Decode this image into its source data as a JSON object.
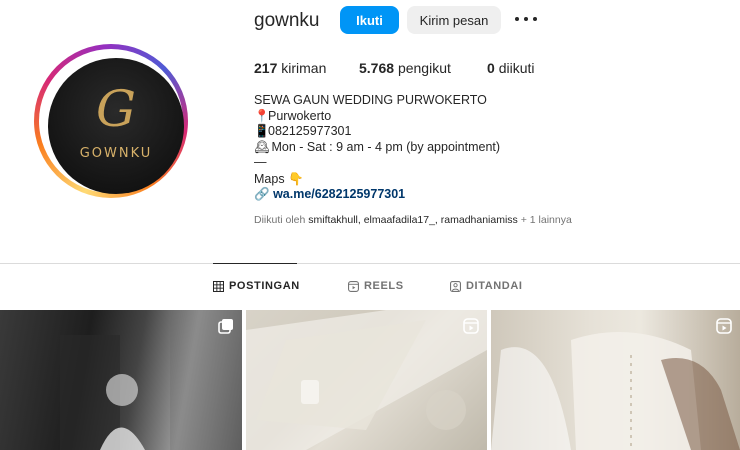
{
  "profile": {
    "username": "gownku",
    "follow_label": "Ikuti",
    "message_label": "Kirim pesan",
    "avatar": {
      "monogram": "G",
      "brand": "GOWNKU"
    },
    "stats": {
      "posts_count": "217",
      "posts_label": "kiriman",
      "followers_count": "5.768",
      "followers_label": "pengikut",
      "following_count": "0",
      "following_label": "diikuti"
    },
    "bio": {
      "name": "SEWA GAUN WEDDING PURWOKERTO",
      "location": "Purwokerto",
      "phone": "082125977301",
      "hours": "Mon - Sat : 9 am - 4 pm (by appointment)",
      "separator": "—",
      "maps": "Maps",
      "link": "wa.me/6282125977301"
    },
    "followed_by": {
      "prefix": "Diikuti oleh",
      "names": "smiftakhull, elmaafadila17_, ramadhaniamiss",
      "suffix": "+ 1 lainnya"
    }
  },
  "tabs": [
    {
      "label": "POSTINGAN",
      "icon": "grid-icon",
      "active": true
    },
    {
      "label": "REELS",
      "icon": "reels-icon",
      "active": false
    },
    {
      "label": "DITANDAI",
      "icon": "tagged-icon",
      "active": false
    }
  ],
  "colors": {
    "accent": "#0095f6",
    "link": "#00376b",
    "text": "#262626",
    "muted": "#737373"
  },
  "posts": [
    {
      "badge": "carousel-icon"
    },
    {
      "badge": "reels-icon"
    },
    {
      "badge": "reels-icon"
    }
  ]
}
